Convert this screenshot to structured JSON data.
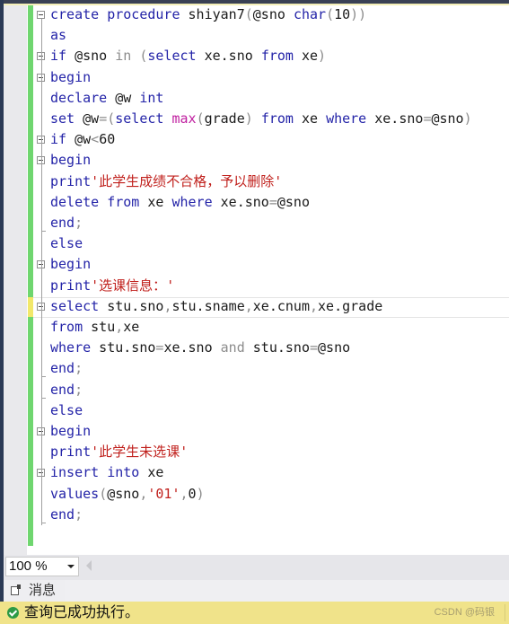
{
  "editor": {
    "lines": [
      {
        "tokens": [
          {
            "t": "create procedure",
            "c": "kw"
          },
          {
            "t": " shiyan7",
            "c": "txt"
          },
          {
            "t": "(",
            "c": "gray"
          },
          {
            "t": "@sno ",
            "c": "txt"
          },
          {
            "t": "char",
            "c": "kw"
          },
          {
            "t": "(",
            "c": "gray"
          },
          {
            "t": "10",
            "c": "txt"
          },
          {
            "t": "))",
            "c": "gray"
          }
        ]
      },
      {
        "tokens": [
          {
            "t": "as",
            "c": "kw"
          }
        ]
      },
      {
        "tokens": [
          {
            "t": "if",
            "c": "kw"
          },
          {
            "t": " @sno ",
            "c": "txt"
          },
          {
            "t": "in",
            "c": "gray"
          },
          {
            "t": " (",
            "c": "gray"
          },
          {
            "t": "select",
            "c": "kw"
          },
          {
            "t": " xe.sno ",
            "c": "txt"
          },
          {
            "t": "from",
            "c": "kw"
          },
          {
            "t": " xe",
            "c": "txt"
          },
          {
            "t": ")",
            "c": "gray"
          }
        ]
      },
      {
        "tokens": [
          {
            "t": "begin",
            "c": "kw"
          }
        ]
      },
      {
        "tokens": [
          {
            "t": "declare",
            "c": "kw"
          },
          {
            "t": " @w ",
            "c": "txt"
          },
          {
            "t": "int",
            "c": "kw"
          }
        ]
      },
      {
        "tokens": [
          {
            "t": "set",
            "c": "kw"
          },
          {
            "t": " @w",
            "c": "txt"
          },
          {
            "t": "=(",
            "c": "gray"
          },
          {
            "t": "select",
            "c": "kw"
          },
          {
            "t": " ",
            "c": "txt"
          },
          {
            "t": "max",
            "c": "fn"
          },
          {
            "t": "(",
            "c": "gray"
          },
          {
            "t": "grade",
            "c": "txt"
          },
          {
            "t": ")",
            "c": "gray"
          },
          {
            "t": " ",
            "c": "txt"
          },
          {
            "t": "from",
            "c": "kw"
          },
          {
            "t": " xe ",
            "c": "txt"
          },
          {
            "t": "where",
            "c": "kw"
          },
          {
            "t": " xe.sno",
            "c": "txt"
          },
          {
            "t": "=",
            "c": "gray"
          },
          {
            "t": "@sno",
            "c": "txt"
          },
          {
            "t": ")",
            "c": "gray"
          }
        ]
      },
      {
        "tokens": [
          {
            "t": "if",
            "c": "kw"
          },
          {
            "t": " @w",
            "c": "txt"
          },
          {
            "t": "<",
            "c": "gray"
          },
          {
            "t": "60",
            "c": "txt"
          }
        ]
      },
      {
        "tokens": [
          {
            "t": "begin",
            "c": "kw"
          }
        ]
      },
      {
        "tokens": [
          {
            "t": "print",
            "c": "kw"
          },
          {
            "t": "'此学生成绩不合格，予以删除'",
            "c": "str"
          }
        ]
      },
      {
        "tokens": [
          {
            "t": "delete from",
            "c": "kw"
          },
          {
            "t": " xe ",
            "c": "txt"
          },
          {
            "t": "where",
            "c": "kw"
          },
          {
            "t": " xe.sno",
            "c": "txt"
          },
          {
            "t": "=",
            "c": "gray"
          },
          {
            "t": "@sno",
            "c": "txt"
          }
        ]
      },
      {
        "tokens": [
          {
            "t": "end",
            "c": "kw"
          },
          {
            "t": ";",
            "c": "gray"
          }
        ]
      },
      {
        "tokens": [
          {
            "t": "else",
            "c": "kw"
          }
        ]
      },
      {
        "tokens": [
          {
            "t": "begin",
            "c": "kw"
          }
        ]
      },
      {
        "tokens": [
          {
            "t": "print",
            "c": "kw"
          },
          {
            "t": "'选课信息：'",
            "c": "str"
          }
        ]
      },
      {
        "tokens": [
          {
            "t": "select",
            "c": "kw"
          },
          {
            "t": " stu.sno",
            "c": "txt"
          },
          {
            "t": ",",
            "c": "gray"
          },
          {
            "t": "stu.sname",
            "c": "txt"
          },
          {
            "t": ",",
            "c": "gray"
          },
          {
            "t": "xe.cnum",
            "c": "txt"
          },
          {
            "t": ",",
            "c": "gray"
          },
          {
            "t": "xe.grade",
            "c": "txt"
          }
        ]
      },
      {
        "tokens": [
          {
            "t": "from",
            "c": "kw"
          },
          {
            "t": " stu",
            "c": "txt"
          },
          {
            "t": ",",
            "c": "gray"
          },
          {
            "t": "xe",
            "c": "txt"
          }
        ]
      },
      {
        "tokens": [
          {
            "t": "where",
            "c": "kw"
          },
          {
            "t": " stu.sno",
            "c": "txt"
          },
          {
            "t": "=",
            "c": "gray"
          },
          {
            "t": "xe.sno ",
            "c": "txt"
          },
          {
            "t": "and",
            "c": "gray"
          },
          {
            "t": " stu.sno",
            "c": "txt"
          },
          {
            "t": "=",
            "c": "gray"
          },
          {
            "t": "@sno",
            "c": "txt"
          }
        ]
      },
      {
        "tokens": [
          {
            "t": "end",
            "c": "kw"
          },
          {
            "t": ";",
            "c": "gray"
          }
        ]
      },
      {
        "tokens": [
          {
            "t": "end",
            "c": "kw"
          },
          {
            "t": ";",
            "c": "gray"
          }
        ]
      },
      {
        "tokens": [
          {
            "t": "else",
            "c": "kw"
          }
        ]
      },
      {
        "tokens": [
          {
            "t": "begin",
            "c": "kw"
          }
        ]
      },
      {
        "tokens": [
          {
            "t": "print",
            "c": "kw"
          },
          {
            "t": "'此学生未选课'",
            "c": "str"
          }
        ]
      },
      {
        "tokens": [
          {
            "t": "insert into",
            "c": "kw"
          },
          {
            "t": " xe",
            "c": "txt"
          }
        ]
      },
      {
        "tokens": [
          {
            "t": "values",
            "c": "kw"
          },
          {
            "t": "(",
            "c": "gray"
          },
          {
            "t": "@sno",
            "c": "txt"
          },
          {
            "t": ",",
            "c": "gray"
          },
          {
            "t": "'01'",
            "c": "str"
          },
          {
            "t": ",",
            "c": "gray"
          },
          {
            "t": "0",
            "c": "txt"
          },
          {
            "t": ")",
            "c": "gray"
          }
        ]
      },
      {
        "tokens": [
          {
            "t": "end",
            "c": "kw"
          },
          {
            "t": ";",
            "c": "gray"
          }
        ]
      }
    ],
    "fold_lines": [
      0,
      2,
      3,
      6,
      7,
      12,
      14,
      20,
      22
    ],
    "current_line": 14
  },
  "zoom": {
    "value": "100 %"
  },
  "results_tabs": [
    {
      "label": "消息",
      "icon": "messages-icon"
    }
  ],
  "status": {
    "text": "查询已成功执行。",
    "icon": "success-check-icon",
    "watermark": "CSDN @码银"
  }
}
